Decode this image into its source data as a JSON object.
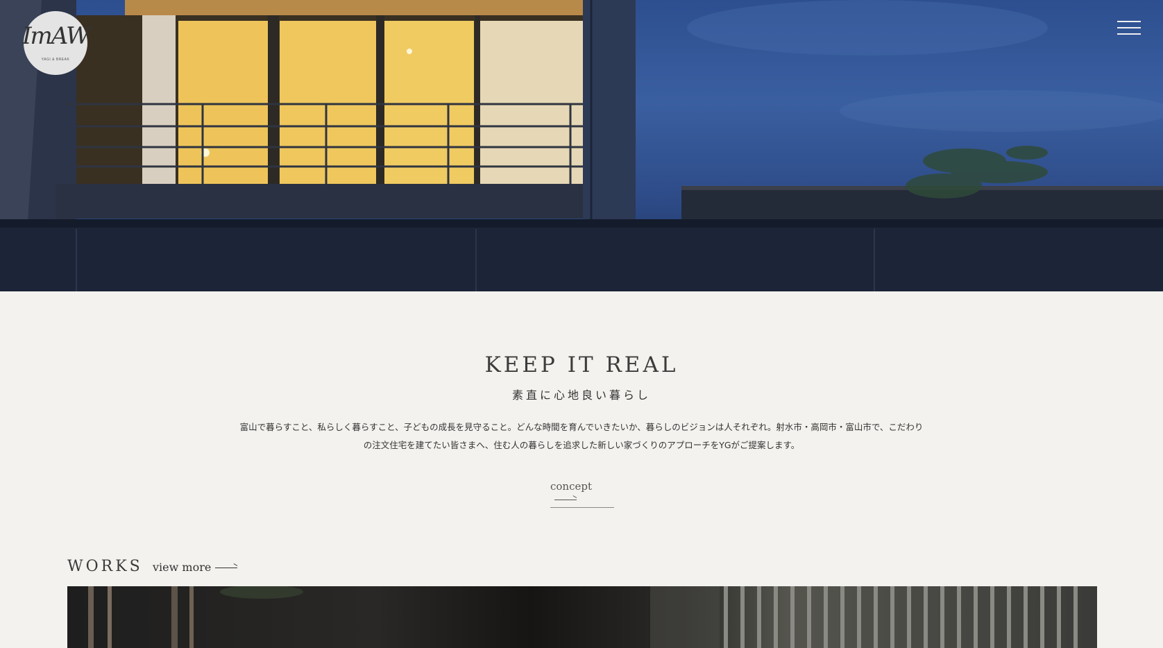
{
  "header": {
    "logo": {
      "mark": "ImAW",
      "subtext": "YAGI & BREAK"
    },
    "menu_icon": "hamburger-menu-icon"
  },
  "concept": {
    "title": "KEEP IT REAL",
    "subtitle": "素直に心地良い暮らし",
    "body_line1": "富山で暮らすこと、私らしく暮らすこと、子どもの成長を見守ること。どんな時間を育んでいきたいか、暮らしのビジョンは人それぞれ。射水市・高岡市・富山市で、こだわり",
    "body_line2": "の注文住宅を建てたい皆さまへ、住む人の暮らしを追求した新しい家づくりのアプローチをYGがご提案します。",
    "link_label": "concept"
  },
  "works": {
    "title": "WORKS",
    "more_label": "view more"
  },
  "colors": {
    "background": "#f3f2ee",
    "hero_sky": "#2d4f90",
    "window_glow": "#f0c95a",
    "text": "#3a3a3a"
  }
}
